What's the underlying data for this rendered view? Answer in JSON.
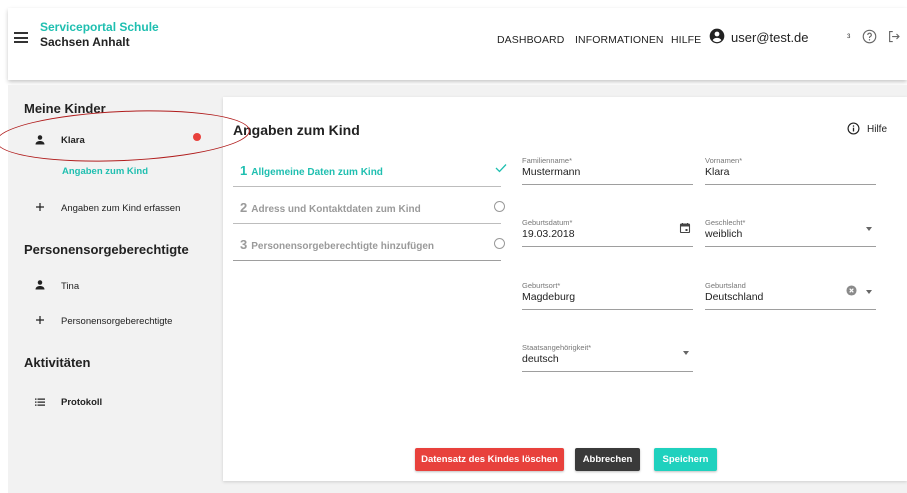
{
  "header": {
    "brand_line1": "Serviceportal Schule",
    "brand_line2": "Sachsen Anhalt",
    "nav": [
      "DASHBOARD",
      "INFORMATIONEN",
      "HILFE"
    ],
    "user": "user@test.de",
    "small_glyph": "³",
    "icons": [
      "menu-icon",
      "account-circle-icon",
      "help-icon",
      "logout-icon"
    ]
  },
  "sidebar": {
    "kinder_title": "Meine Kinder",
    "child_name": "Klara",
    "child_sublink": "Angaben zum Kind",
    "add_child": "Angaben zum Kind erfassen",
    "guardians_title": "Personensorgeberechtigte",
    "guardian_name": "Tina",
    "add_guardian": "Personensorgeberechtigte",
    "activities_title": "Aktivitäten",
    "protocol": "Protokoll"
  },
  "form": {
    "title": "Angaben zum Kind",
    "help": "Hilfe",
    "steps": [
      {
        "num": "1",
        "label": "Allgemeine Daten zum Kind",
        "status": "done"
      },
      {
        "num": "2",
        "label": "Adress und Kontaktdaten zum Kind",
        "status": "open"
      },
      {
        "num": "3",
        "label": "Personensorgeberechtigte hinzufügen",
        "status": "open"
      }
    ],
    "fields": {
      "familienname": {
        "label": "Familienname*",
        "value": "Mustermann"
      },
      "vornamen": {
        "label": "Vornamen*",
        "value": "Klara"
      },
      "geburtsdatum": {
        "label": "Geburtsdatum*",
        "value": "19.03.2018"
      },
      "geschlecht": {
        "label": "Geschlecht*",
        "value": "weiblich"
      },
      "geburtsort": {
        "label": "Geburtsort*",
        "value": "Magdeburg"
      },
      "geburtsland": {
        "label": "Geburtsland",
        "value": "Deutschland"
      },
      "staatsangehoerigkeit": {
        "label": "Staatsangehörigkeit*",
        "value": "deutsch"
      }
    },
    "buttons": {
      "delete": "Datensatz des Kindes löschen",
      "cancel": "Abbrechen",
      "save": "Speichern"
    }
  },
  "colors": {
    "accent": "#1fbfb0",
    "danger": "#e8413c",
    "dark": "#3a3a3a",
    "annotation": "#b01c1c"
  }
}
